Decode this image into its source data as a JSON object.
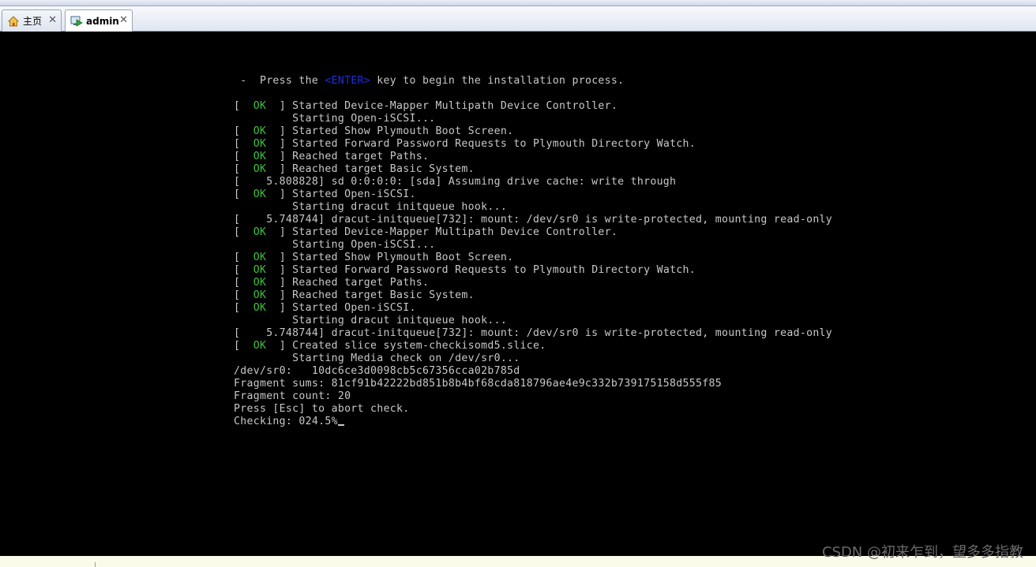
{
  "tabs": [
    {
      "label": "主页",
      "icon": "home-icon",
      "active": false
    },
    {
      "label": "admin",
      "icon": "vm-running-icon",
      "active": true
    }
  ],
  "console": {
    "prompt_prefix": " -  Press the ",
    "prompt_key": "<ENTER>",
    "prompt_suffix": " key to begin the installation process.",
    "lines": [
      {
        "ok": true,
        "text": " ] Started Device-Mapper Multipath Device Controller."
      },
      {
        "ok": false,
        "text": "         Starting Open-iSCSI..."
      },
      {
        "ok": true,
        "text": " ] Started Show Plymouth Boot Screen."
      },
      {
        "ok": true,
        "text": " ] Started Forward Password Requests to Plymouth Directory Watch."
      },
      {
        "ok": true,
        "text": " ] Reached target Paths."
      },
      {
        "ok": true,
        "text": " ] Reached target Basic System."
      },
      {
        "ok": false,
        "text": "[    5.808828] sd 0:0:0:0: [sda] Assuming drive cache: write through"
      },
      {
        "ok": true,
        "text": " ] Started Open-iSCSI."
      },
      {
        "ok": false,
        "text": "         Starting dracut initqueue hook..."
      },
      {
        "ok": false,
        "text": "[    5.748744] dracut-initqueue[732]: mount: /dev/sr0 is write-protected, mounting read-only"
      },
      {
        "ok": true,
        "text": " ] Started Device-Mapper Multipath Device Controller."
      },
      {
        "ok": false,
        "text": "         Starting Open-iSCSI..."
      },
      {
        "ok": true,
        "text": " ] Started Show Plymouth Boot Screen."
      },
      {
        "ok": true,
        "text": " ] Started Forward Password Requests to Plymouth Directory Watch."
      },
      {
        "ok": true,
        "text": " ] Reached target Paths."
      },
      {
        "ok": true,
        "text": " ] Reached target Basic System."
      },
      {
        "ok": true,
        "text": " ] Started Open-iSCSI."
      },
      {
        "ok": false,
        "text": "         Starting dracut initqueue hook..."
      },
      {
        "ok": false,
        "text": "[    5.748744] dracut-initqueue[732]: mount: /dev/sr0 is write-protected, mounting read-only"
      },
      {
        "ok": true,
        "text": " ] Created slice system-checkisomd5.slice."
      },
      {
        "ok": false,
        "text": "         Starting Media check on /dev/sr0..."
      },
      {
        "ok": false,
        "text": "/dev/sr0:   10dc6ce3d0098cb5c67356cca02b785d"
      },
      {
        "ok": false,
        "text": "Fragment sums: 81cf91b42222bd851b8b4bf68cda818796ae4e9c332b739175158d555f85"
      },
      {
        "ok": false,
        "text": "Fragment count: 20"
      },
      {
        "ok": false,
        "text": "Press [Esc] to abort check."
      },
      {
        "ok": false,
        "text": "Checking: 024.5%"
      }
    ],
    "ok_open": "[  ",
    "ok_label": "OK",
    "ok_gap": " "
  },
  "watermark": "CSDN @初来乍到，望多多指教",
  "colors": {
    "ok": "#3bc13b",
    "enter_key": "#1d2fd6",
    "console_text": "#c8c8c8"
  }
}
